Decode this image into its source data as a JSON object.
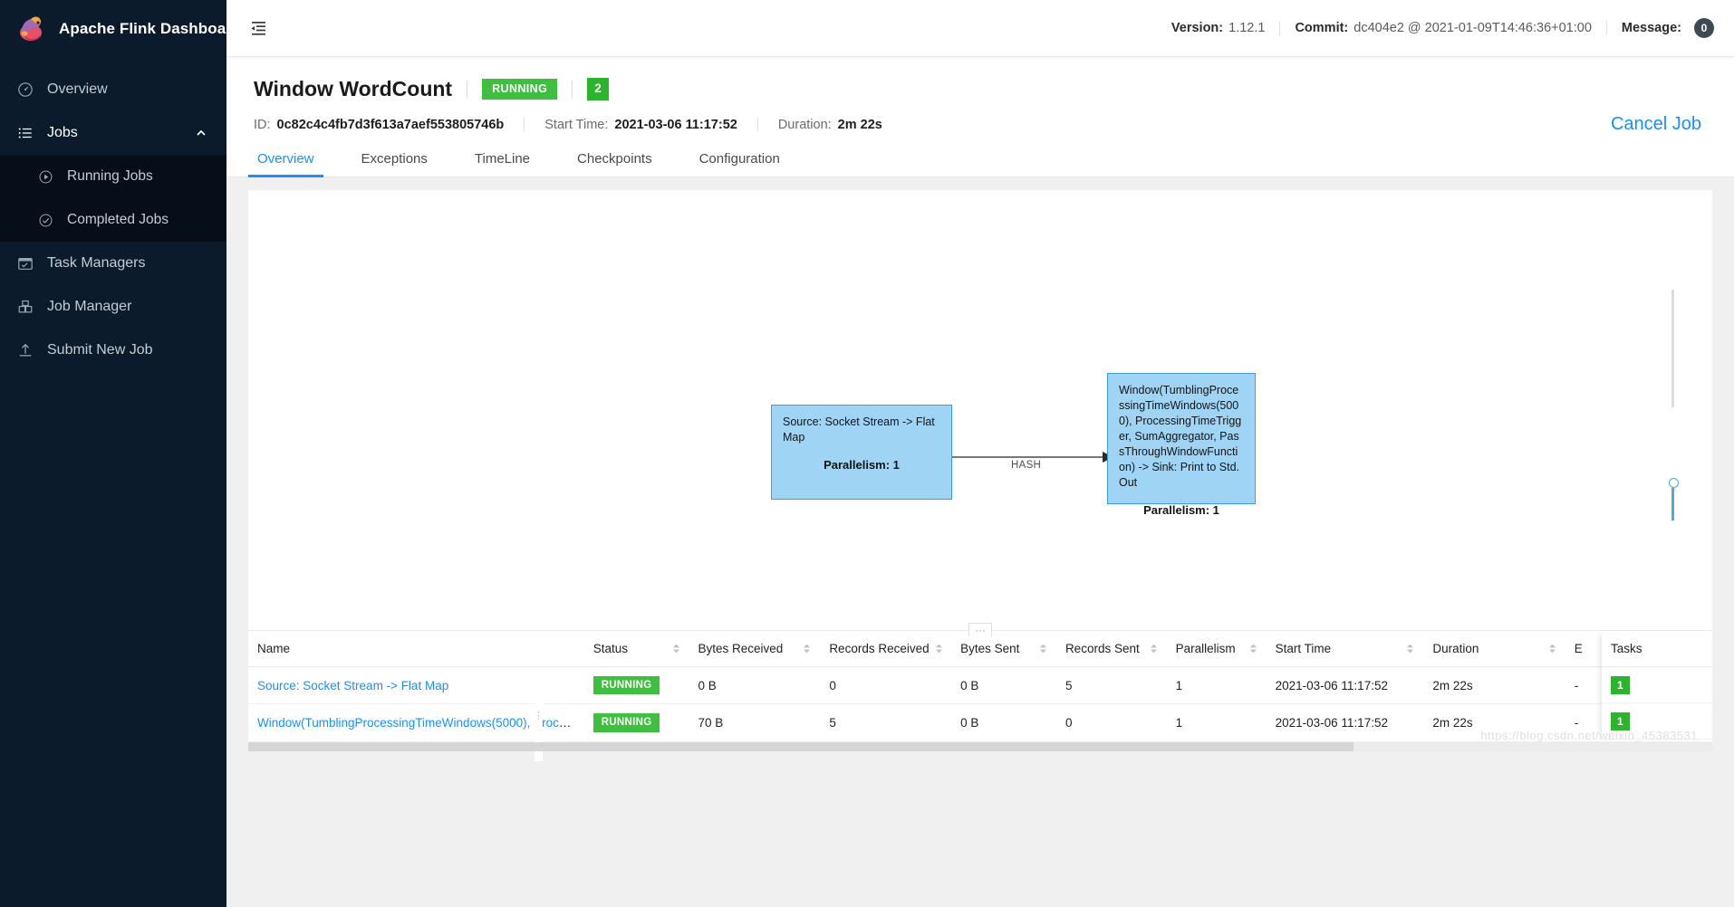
{
  "brand": {
    "title": "Apache Flink Dashboard",
    "logo_icon": "flink-squirrel-logo"
  },
  "sidebar": {
    "items": [
      {
        "label": "Overview",
        "icon": "dashboard-icon"
      },
      {
        "label": "Jobs",
        "icon": "list-icon",
        "caret": "chevron-up-icon"
      },
      {
        "label": "Running Jobs",
        "icon": "play-circle-icon"
      },
      {
        "label": "Completed Jobs",
        "icon": "check-circle-icon"
      },
      {
        "label": "Task Managers",
        "icon": "task-manager-icon"
      },
      {
        "label": "Job Manager",
        "icon": "job-manager-icon"
      },
      {
        "label": "Submit New Job",
        "icon": "upload-icon"
      }
    ]
  },
  "topbar": {
    "collapse_icon": "menu-fold-icon",
    "version_label": "Version:",
    "version_value": "1.12.1",
    "commit_label": "Commit:",
    "commit_value": "dc404e2 @ 2021-01-09T14:46:36+01:00",
    "message_label": "Message:",
    "message_count": "0"
  },
  "job": {
    "title": "Window WordCount",
    "status": "RUNNING",
    "vertex_count": "2",
    "id_label": "ID:",
    "id_value": "0c82c4c4fb7d3f613a7aef553805746b",
    "start_time_label": "Start Time:",
    "start_time_value": "2021-03-06 11:17:52",
    "duration_label": "Duration:",
    "duration_value": "2m 22s",
    "cancel_label": "Cancel Job"
  },
  "tabs": [
    {
      "label": "Overview",
      "active": true
    },
    {
      "label": "Exceptions",
      "active": false
    },
    {
      "label": "TimeLine",
      "active": false
    },
    {
      "label": "Checkpoints",
      "active": false
    },
    {
      "label": "Configuration",
      "active": false
    }
  ],
  "graph": {
    "nodes": [
      {
        "label": "Source: Socket Stream -> Flat Map",
        "parallelism": "Parallelism: 1"
      },
      {
        "label": "Window(TumblingProcessingTimeWindows(5000), ProcessingTimeTrigger, SumAggregator, PassThroughWindowFunction) -> Sink: Print to Std. Out",
        "parallelism": "Parallelism: 1"
      }
    ],
    "edge_label": "HASH",
    "drag_handle_icon": "drag-dots-icon"
  },
  "table": {
    "columns": [
      "Name",
      "Status",
      "Bytes Received",
      "Records Received",
      "Bytes Sent",
      "Records Sent",
      "Parallelism",
      "Start Time",
      "Duration",
      "E"
    ],
    "pinned_column": "Tasks",
    "rows": [
      {
        "name": "Source: Socket Stream -> Flat Map",
        "status": "RUNNING",
        "bytes_received": "0 B",
        "records_received": "0",
        "bytes_sent": "0 B",
        "records_sent": "5",
        "parallelism": "1",
        "start_time": "2021-03-06 11:17:52",
        "duration": "2m 22s",
        "end_time": "-",
        "tasks": "1"
      },
      {
        "name": "Window(TumblingProcessingTimeWindows(5000), ProcessingTi...",
        "status": "RUNNING",
        "bytes_received": "70 B",
        "records_received": "5",
        "bytes_sent": "0 B",
        "records_sent": "0",
        "parallelism": "1",
        "start_time": "2021-03-06 11:17:52",
        "duration": "2m 22s",
        "end_time": "-",
        "tasks": "1"
      }
    ]
  },
  "watermark": "https://blog.csdn.net/weixin_45383531",
  "colors": {
    "sidebar_bg": "#0b1b2b",
    "accent_blue": "#1890ff",
    "status_green": "#3fbf3f",
    "node_fill": "#9fd4f5",
    "node_border": "#3f9ddc"
  }
}
